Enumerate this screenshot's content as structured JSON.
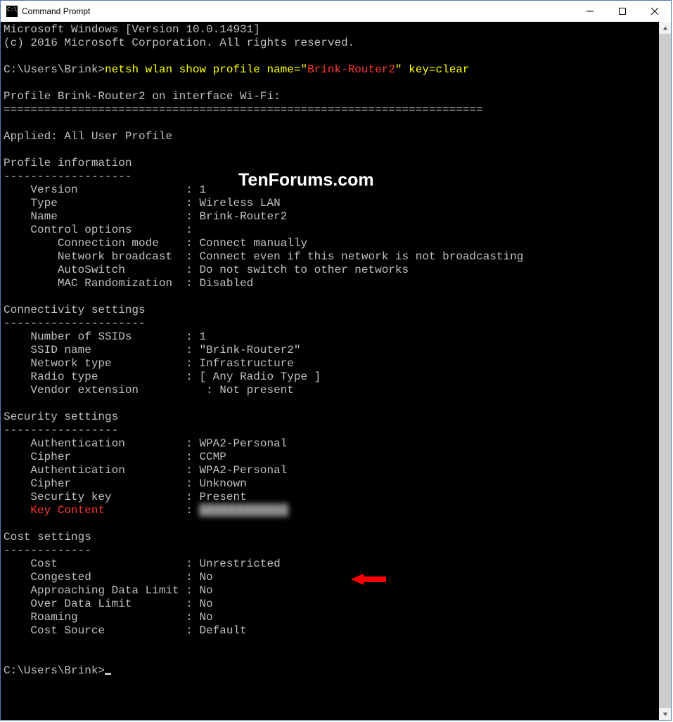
{
  "window": {
    "title": "Command Prompt"
  },
  "watermark": "TenForums.com",
  "header": {
    "line1": "Microsoft Windows [Version 10.0.14931]",
    "line2": "(c) 2016 Microsoft Corporation. All rights reserved."
  },
  "prompt1": {
    "path": "C:\\Users\\Brink>",
    "cmd_pre": "netsh wlan show profile name=\"",
    "cmd_name": "Brink-Router2",
    "cmd_post": "\" key=clear"
  },
  "profile_header": {
    "title": "Profile Brink-Router2 on interface Wi-Fi:",
    "rule": "======================================================================="
  },
  "applied": "Applied: All User Profile",
  "sections": {
    "profile_info": {
      "title": "Profile information",
      "rule": "-------------------",
      "rows": [
        {
          "k": "    Version                ",
          "v": "1"
        },
        {
          "k": "    Type                   ",
          "v": "Wireless LAN"
        },
        {
          "k": "    Name                   ",
          "v": "Brink-Router2"
        },
        {
          "k": "    Control options        ",
          "v": ""
        },
        {
          "k": "        Connection mode    ",
          "v": "Connect manually"
        },
        {
          "k": "        Network broadcast  ",
          "v": "Connect even if this network is not broadcasting"
        },
        {
          "k": "        AutoSwitch         ",
          "v": "Do not switch to other networks"
        },
        {
          "k": "        MAC Randomization  ",
          "v": "Disabled"
        }
      ]
    },
    "connectivity": {
      "title": "Connectivity settings",
      "rule": "---------------------",
      "rows": [
        {
          "k": "    Number of SSIDs        ",
          "v": "1"
        },
        {
          "k": "    SSID name              ",
          "v": "\"Brink-Router2\""
        },
        {
          "k": "    Network type           ",
          "v": "Infrastructure"
        },
        {
          "k": "    Radio type             ",
          "v": "[ Any Radio Type ]"
        },
        {
          "k": "    Vendor extension          ",
          "v2": "Not present"
        }
      ]
    },
    "security": {
      "title": "Security settings",
      "rule": "-----------------",
      "rows": [
        {
          "k": "    Authentication         ",
          "v": "WPA2-Personal"
        },
        {
          "k": "    Cipher                 ",
          "v": "CCMP"
        },
        {
          "k": "    Authentication         ",
          "v": "WPA2-Personal"
        },
        {
          "k": "    Cipher                 ",
          "v": "Unknown"
        },
        {
          "k": "    Security key           ",
          "v": "Present"
        }
      ],
      "key_row": {
        "k": "    Key Content            ",
        "v_masked": "████████████"
      }
    },
    "cost": {
      "title": "Cost settings",
      "rule": "-------------",
      "rows": [
        {
          "k": "    Cost                   ",
          "v": "Unrestricted"
        },
        {
          "k": "    Congested              ",
          "v": "No"
        },
        {
          "k": "    Approaching Data Limit ",
          "v": "No"
        },
        {
          "k": "    Over Data Limit        ",
          "v": "No"
        },
        {
          "k": "    Roaming                ",
          "v": "No"
        },
        {
          "k": "    Cost Source            ",
          "v": "Default"
        }
      ]
    }
  },
  "prompt2": {
    "path": "C:\\Users\\Brink>"
  }
}
